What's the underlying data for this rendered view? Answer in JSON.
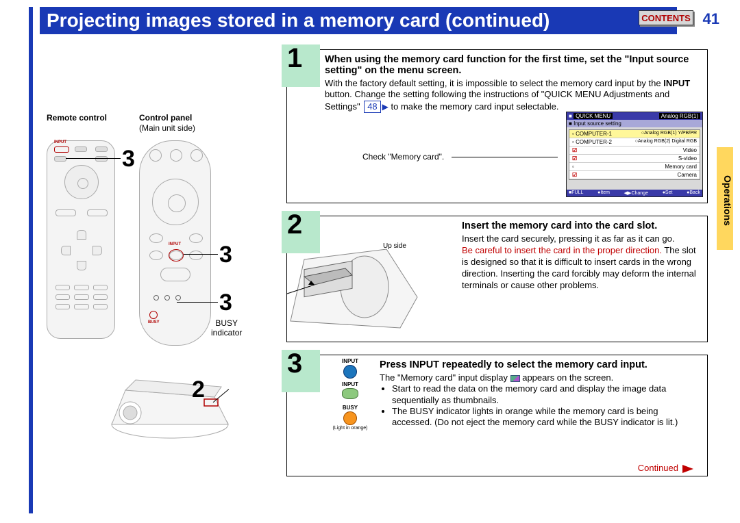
{
  "title": "Projecting images stored in a memory card (continued)",
  "contents_btn": "CONTENTS",
  "page_num": "41",
  "side_tab": "Operations",
  "left": {
    "remote_label": "Remote control",
    "cp_label": "Control panel",
    "cp_sub": "(Main unit side)",
    "busy_ind": "BUSY\nindicator",
    "input_lbl": "INPUT",
    "busy_lbl": "BUSY",
    "num3": "3",
    "num2": "2"
  },
  "step1": {
    "num": "1",
    "head1": "When using the memory card function for the first time, set the \"Input source setting\" on the menu screen.",
    "body1_a": "With the factory default setting, it is impossible to select the memory card input by the ",
    "body1_b": "INPUT",
    "body1_c": " button. Change the setting following the instructions of \"QUICK MENU Adjustments and Settings\" ",
    "page_ref": "48",
    "body1_d": " to make the memory card input selectable.",
    "check": "Check \"Memory card\".",
    "menu": {
      "title": "QUICK MENU",
      "mode": "Analog RGB(1)",
      "sub": "Input source setting",
      "items": [
        {
          "l": "COMPUTER-1",
          "r": "Analog RGB(1) Y/PB/PR"
        },
        {
          "l": "COMPUTER-2",
          "r": "Analog RGB(2) Digital RGB"
        },
        {
          "l": "Video",
          "r": ""
        },
        {
          "l": "S-video",
          "r": ""
        },
        {
          "l": "Memory card",
          "r": ""
        },
        {
          "l": "Camera",
          "r": ""
        }
      ],
      "foot": [
        "FULL",
        "Item",
        "Change",
        "Set",
        "Back"
      ]
    }
  },
  "step2": {
    "num": "2",
    "head": "Insert the memory card into the card slot.",
    "upside": "Up side",
    "t1": "Insert the card securely, pressing it as far as it can go.",
    "t2_red": "Be careful to insert the card in the proper direction.",
    "t2": " The slot is designed so that it is difficult to insert cards in the wrong direction. Inserting the card forcibly may deform the internal terminals or cause other problems."
  },
  "step3": {
    "num": "3",
    "head": "Press INPUT repeatedly to select the memory card input.",
    "icons": {
      "input": "INPUT",
      "busy": "BUSY",
      "light": "(Light in orange)"
    },
    "t1_a": "The \"Memory card\" input display ",
    "t1_b": " appears on the screen.",
    "b1": "Start to read the data on the memory card and display the image data sequentially as thumbnails.",
    "b2": "The BUSY indicator lights in orange while the memory card is being accessed. (Do not eject the memory card while the BUSY indicator is lit.)"
  },
  "continued": "Continued"
}
